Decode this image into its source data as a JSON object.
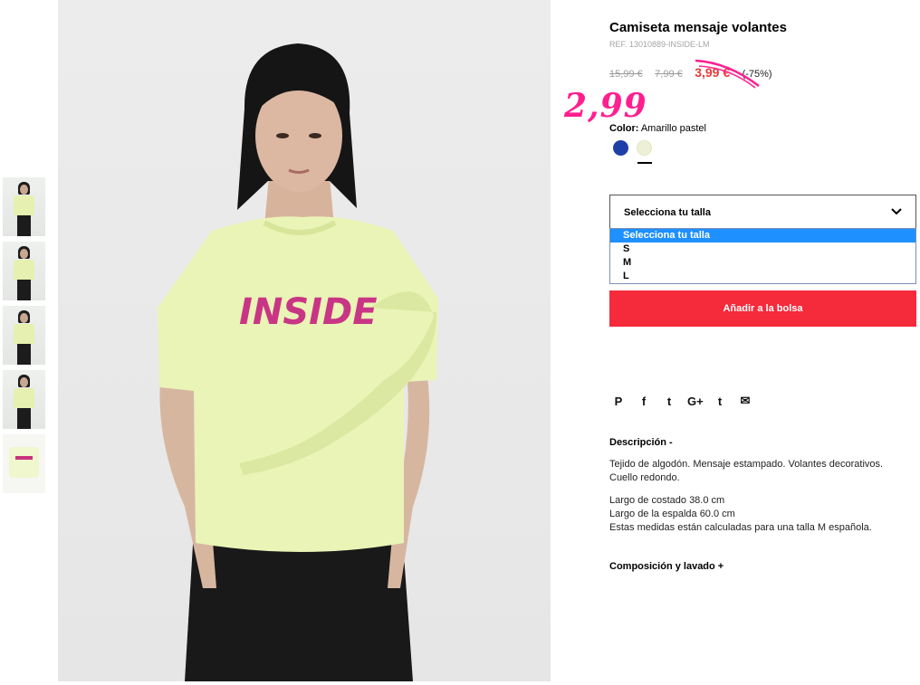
{
  "product": {
    "title": "Camiseta mensaje volantes",
    "ref": "REF. 13010889-INSIDE-LM",
    "prices": {
      "original": "15,99 €",
      "previous": "7,99 €",
      "current": "3,99 €",
      "discount": "(-75%)",
      "annotated_price": "2,99"
    },
    "color": {
      "label": "Color:",
      "value": "Amarillo pastel",
      "swatches": [
        {
          "name": "blue",
          "hex": "#1f3fa8"
        },
        {
          "name": "amarillo-pastel",
          "hex": "#eef0d6"
        }
      ]
    },
    "size": {
      "placeholder": "Selecciona tu talla",
      "options": [
        "Selecciona tu talla",
        "S",
        "M",
        "L"
      ],
      "selected": "Selecciona tu talla"
    },
    "add_to_bag": "Añadir a la bolsa",
    "print_text": "INSIDE"
  },
  "social": [
    {
      "icon": "pinterest-icon",
      "glyph": "P"
    },
    {
      "icon": "facebook-icon",
      "glyph": "f"
    },
    {
      "icon": "twitter-icon",
      "glyph": "t"
    },
    {
      "icon": "google-plus-icon",
      "glyph": "G+"
    },
    {
      "icon": "tumblr-icon",
      "glyph": "t"
    },
    {
      "icon": "email-icon",
      "glyph": "✉"
    }
  ],
  "description": {
    "heading": "Descripción -",
    "para1": "Tejido de algodón. Mensaje estampado. Volantes decorativos. Cuello redondo.",
    "line1": "Largo de costado 38.0 cm",
    "line2": "Largo de la espalda 60.0 cm",
    "line3": "Estas medidas están calculadas para una talla M española."
  },
  "composition": {
    "heading": "Composición y lavado +"
  },
  "colors": {
    "accent_red": "#f52a3b",
    "price_red": "#e8393a",
    "annotation_pink": "#ff1f8f",
    "dropdown_highlight": "#1e90ff"
  }
}
